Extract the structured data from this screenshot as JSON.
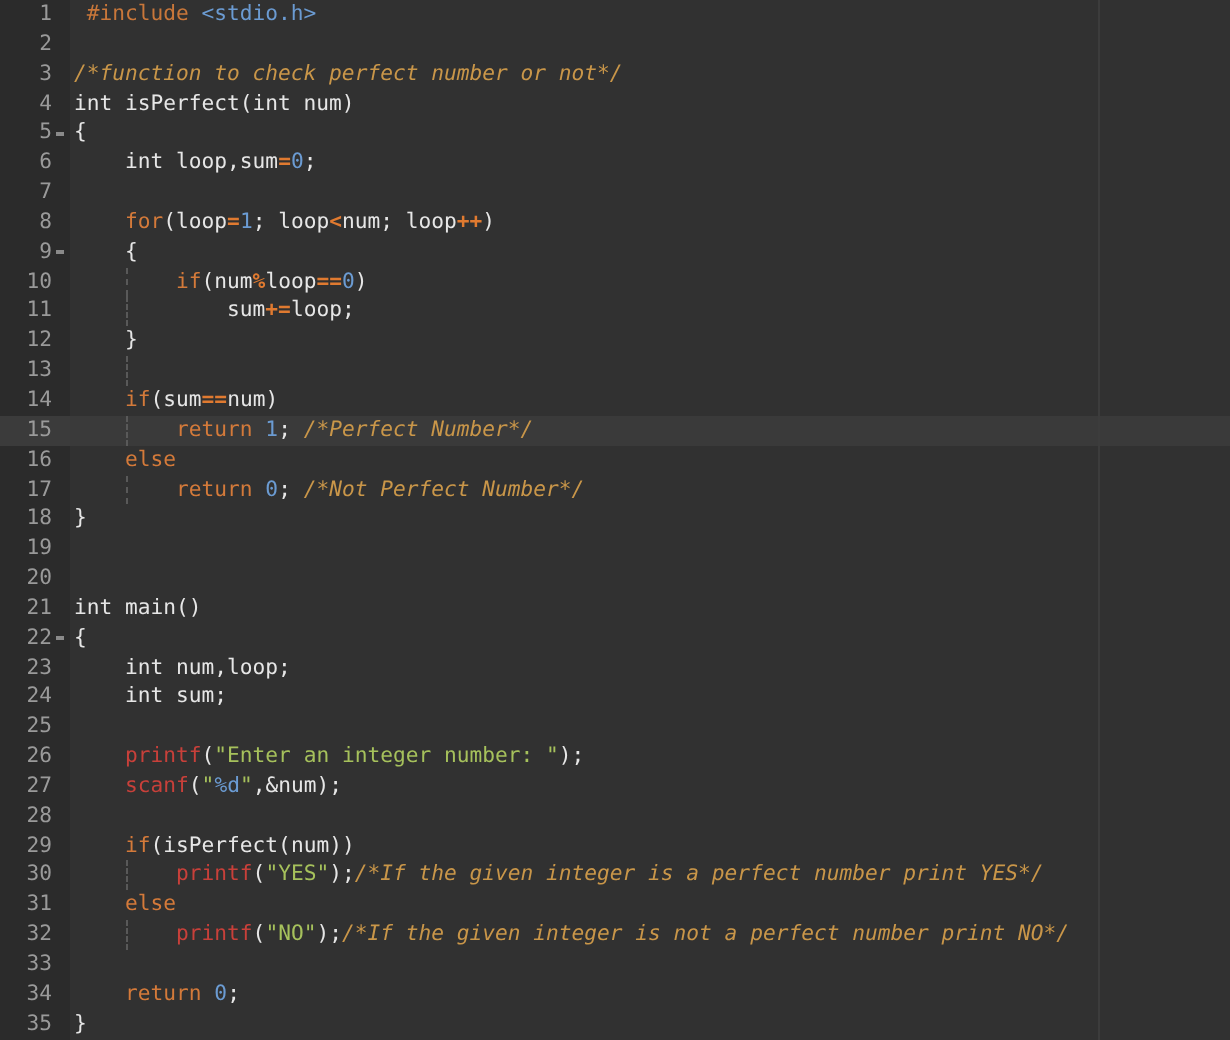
{
  "editor": {
    "lines": [
      {
        "number": "1",
        "fold": false,
        "current": false,
        "guide": false,
        "tokens": [
          {
            "kind": "preproc",
            "text": " #include "
          },
          {
            "kind": "header",
            "text": "<stdio.h>"
          }
        ]
      },
      {
        "number": "2",
        "fold": false,
        "current": false,
        "guide": false
      },
      {
        "number": "3",
        "fold": false,
        "current": false,
        "guide": false,
        "tokens": [
          {
            "kind": "comment",
            "text": "/*function to check perfect number or not*/"
          }
        ]
      },
      {
        "number": "4",
        "fold": false,
        "current": false,
        "guide": false,
        "tokens": [
          {
            "kind": "plain",
            "text": "int isPerfect(int num)"
          }
        ]
      },
      {
        "number": "5",
        "fold": true,
        "current": false,
        "guide": false,
        "tokens": [
          {
            "kind": "plain",
            "text": "{"
          }
        ]
      },
      {
        "number": "6",
        "fold": false,
        "current": false,
        "guide": false,
        "tokens": [
          {
            "kind": "plain",
            "text": "    int loop,sum"
          },
          {
            "kind": "operator",
            "text": "="
          },
          {
            "kind": "number",
            "text": "0"
          },
          {
            "kind": "plain",
            "text": ";"
          }
        ]
      },
      {
        "number": "7",
        "fold": false,
        "current": false,
        "guide": false
      },
      {
        "number": "8",
        "fold": false,
        "current": false,
        "guide": false,
        "tokens": [
          {
            "kind": "keyword",
            "text": "    for"
          },
          {
            "kind": "plain",
            "text": "(loop"
          },
          {
            "kind": "operator",
            "text": "="
          },
          {
            "kind": "number",
            "text": "1"
          },
          {
            "kind": "plain",
            "text": "; loop"
          },
          {
            "kind": "operator",
            "text": "<"
          },
          {
            "kind": "plain",
            "text": "num; loop"
          },
          {
            "kind": "operator",
            "text": "++"
          },
          {
            "kind": "plain",
            "text": ")"
          }
        ]
      },
      {
        "number": "9",
        "fold": true,
        "current": false,
        "guide": false,
        "tokens": [
          {
            "kind": "plain",
            "text": "    {"
          }
        ]
      },
      {
        "number": "10",
        "fold": false,
        "current": false,
        "guide": true,
        "tokens": [
          {
            "kind": "keyword",
            "text": "        if"
          },
          {
            "kind": "plain",
            "text": "(num"
          },
          {
            "kind": "operator",
            "text": "%"
          },
          {
            "kind": "plain",
            "text": "loop"
          },
          {
            "kind": "operator",
            "text": "=="
          },
          {
            "kind": "number",
            "text": "0"
          },
          {
            "kind": "plain",
            "text": ")"
          }
        ]
      },
      {
        "number": "11",
        "fold": false,
        "current": false,
        "guide": true,
        "tokens": [
          {
            "kind": "plain",
            "text": "            sum"
          },
          {
            "kind": "operator",
            "text": "+="
          },
          {
            "kind": "plain",
            "text": "loop;"
          }
        ]
      },
      {
        "number": "12",
        "fold": false,
        "current": false,
        "guide": false,
        "tokens": [
          {
            "kind": "plain",
            "text": "    }"
          }
        ]
      },
      {
        "number": "13",
        "fold": false,
        "current": false,
        "guide": true
      },
      {
        "number": "14",
        "fold": false,
        "current": false,
        "guide": false,
        "tokens": [
          {
            "kind": "keyword",
            "text": "    if"
          },
          {
            "kind": "plain",
            "text": "(sum"
          },
          {
            "kind": "operator",
            "text": "=="
          },
          {
            "kind": "plain",
            "text": "num)"
          }
        ]
      },
      {
        "number": "15",
        "fold": false,
        "current": true,
        "guide": true,
        "tokens": [
          {
            "kind": "keyword",
            "text": "        return "
          },
          {
            "kind": "number",
            "text": "1"
          },
          {
            "kind": "plain",
            "text": "; "
          },
          {
            "kind": "comment",
            "text": "/*Perfect Number*/"
          }
        ]
      },
      {
        "number": "16",
        "fold": false,
        "current": false,
        "guide": false,
        "tokens": [
          {
            "kind": "keyword",
            "text": "    else"
          }
        ]
      },
      {
        "number": "17",
        "fold": false,
        "current": false,
        "guide": true,
        "tokens": [
          {
            "kind": "keyword",
            "text": "        return "
          },
          {
            "kind": "number",
            "text": "0"
          },
          {
            "kind": "plain",
            "text": "; "
          },
          {
            "kind": "comment",
            "text": "/*Not Perfect Number*/"
          }
        ]
      },
      {
        "number": "18",
        "fold": false,
        "current": false,
        "guide": false,
        "tokens": [
          {
            "kind": "plain",
            "text": "}"
          }
        ]
      },
      {
        "number": "19",
        "fold": false,
        "current": false,
        "guide": false
      },
      {
        "number": "20",
        "fold": false,
        "current": false,
        "guide": false
      },
      {
        "number": "21",
        "fold": false,
        "current": false,
        "guide": false,
        "tokens": [
          {
            "kind": "plain",
            "text": "int main()"
          }
        ]
      },
      {
        "number": "22",
        "fold": true,
        "current": false,
        "guide": false,
        "tokens": [
          {
            "kind": "plain",
            "text": "{"
          }
        ]
      },
      {
        "number": "23",
        "fold": false,
        "current": false,
        "guide": false,
        "tokens": [
          {
            "kind": "plain",
            "text": "    int num,loop;"
          }
        ]
      },
      {
        "number": "24",
        "fold": false,
        "current": false,
        "guide": false,
        "tokens": [
          {
            "kind": "plain",
            "text": "    int sum;"
          }
        ]
      },
      {
        "number": "25",
        "fold": false,
        "current": false,
        "guide": false
      },
      {
        "number": "26",
        "fold": false,
        "current": false,
        "guide": false,
        "tokens": [
          {
            "kind": "function",
            "text": "    printf"
          },
          {
            "kind": "plain",
            "text": "("
          },
          {
            "kind": "string",
            "text": "\"Enter an integer number: \""
          },
          {
            "kind": "plain",
            "text": ");"
          }
        ]
      },
      {
        "number": "27",
        "fold": false,
        "current": false,
        "guide": false,
        "tokens": [
          {
            "kind": "function",
            "text": "    scanf"
          },
          {
            "kind": "plain",
            "text": "("
          },
          {
            "kind": "string",
            "text": "\""
          },
          {
            "kind": "number",
            "text": "%d"
          },
          {
            "kind": "string",
            "text": "\""
          },
          {
            "kind": "plain",
            "text": ",&num);"
          }
        ]
      },
      {
        "number": "28",
        "fold": false,
        "current": false,
        "guide": false
      },
      {
        "number": "29",
        "fold": false,
        "current": false,
        "guide": false,
        "tokens": [
          {
            "kind": "keyword",
            "text": "    if"
          },
          {
            "kind": "plain",
            "text": "(isPerfect(num))"
          }
        ]
      },
      {
        "number": "30",
        "fold": false,
        "current": false,
        "guide": true,
        "tokens": [
          {
            "kind": "function",
            "text": "        printf"
          },
          {
            "kind": "plain",
            "text": "("
          },
          {
            "kind": "string",
            "text": "\"YES\""
          },
          {
            "kind": "plain",
            "text": ");"
          },
          {
            "kind": "comment",
            "text": "/*If the given integer is a perfect number print YES*/"
          }
        ]
      },
      {
        "number": "31",
        "fold": false,
        "current": false,
        "guide": false,
        "tokens": [
          {
            "kind": "keyword",
            "text": "    else"
          }
        ]
      },
      {
        "number": "32",
        "fold": false,
        "current": false,
        "guide": true,
        "tokens": [
          {
            "kind": "function",
            "text": "        printf"
          },
          {
            "kind": "plain",
            "text": "("
          },
          {
            "kind": "string",
            "text": "\"NO\""
          },
          {
            "kind": "plain",
            "text": ");"
          },
          {
            "kind": "comment",
            "text": "/*If the given integer is not a perfect number print NO*/"
          }
        ]
      },
      {
        "number": "33",
        "fold": false,
        "current": false,
        "guide": false
      },
      {
        "number": "34",
        "fold": false,
        "current": false,
        "guide": false,
        "tokens": [
          {
            "kind": "keyword",
            "text": "    return "
          },
          {
            "kind": "number",
            "text": "0"
          },
          {
            "kind": "plain",
            "text": ";"
          }
        ]
      },
      {
        "number": "35",
        "fold": false,
        "current": false,
        "guide": false,
        "tokens": [
          {
            "kind": "plain",
            "text": "}"
          }
        ]
      }
    ]
  }
}
